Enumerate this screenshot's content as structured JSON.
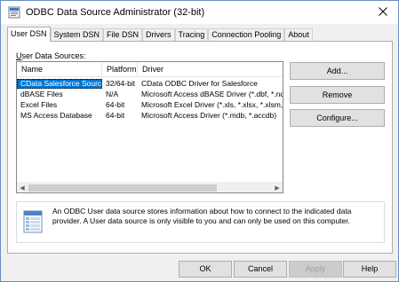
{
  "window": {
    "title": "ODBC Data Source Administrator (32-bit)",
    "close_glyph": "✕"
  },
  "tabs": [
    {
      "label": "User DSN",
      "active": true
    },
    {
      "label": "System DSN"
    },
    {
      "label": "File DSN"
    },
    {
      "label": "Drivers"
    },
    {
      "label": "Tracing"
    },
    {
      "label": "Connection Pooling"
    },
    {
      "label": "About"
    }
  ],
  "panel": {
    "section_label_prefix": "U",
    "section_label_rest": "ser Data Sources:",
    "columns": [
      "Name",
      "Platform",
      "Driver"
    ],
    "rows": [
      {
        "name": "CData Salesforce Source",
        "platform": "32/64-bit",
        "driver": "CData ODBC Driver for Salesforce"
      },
      {
        "name": "dBASE Files",
        "platform": "N/A",
        "driver": "Microsoft Access dBASE Driver (*.dbf, *.ndx"
      },
      {
        "name": "Excel Files",
        "platform": "64-bit",
        "driver": "Microsoft Excel Driver (*.xls, *.xlsx, *.xlsm, *.x"
      },
      {
        "name": "MS Access Database",
        "platform": "64-bit",
        "driver": "Microsoft Access Driver (*.mdb, *.accdb)"
      }
    ],
    "buttons": {
      "add": "Add...",
      "remove": "Remove",
      "configure": "Configure..."
    },
    "info_text": "An ODBC User data source stores information about how to connect to the indicated data provider.  A User data source is only visible to you and can only be used on this computer."
  },
  "footer": {
    "ok": "OK",
    "cancel": "Cancel",
    "apply": "Apply",
    "help": "Help"
  },
  "colors": {
    "selection": "#0078d7",
    "accent_border": "#0078d7"
  },
  "icons": {
    "title": "odbc-admin-icon",
    "info": "data-source-info-icon"
  }
}
